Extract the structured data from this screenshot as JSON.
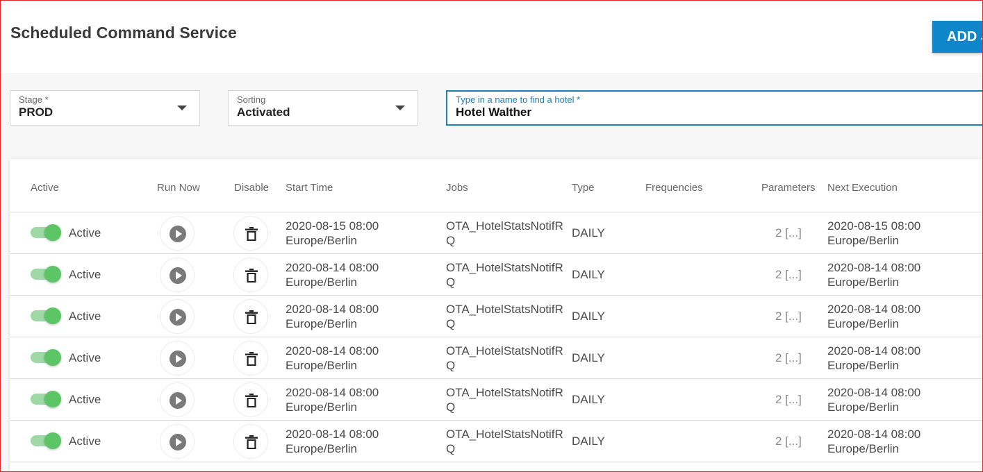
{
  "app": {
    "title": "Scheduled Command Service",
    "add_button_label": "ADD J"
  },
  "filters": {
    "stage": {
      "label": "Stage *",
      "value": "PROD"
    },
    "sorting": {
      "label": "Sorting",
      "value": "Activated"
    },
    "hotel_search": {
      "label": "Type in a name to find a hotel *",
      "value": "Hotel Walther"
    }
  },
  "table": {
    "columns": [
      "Active",
      "Run Now",
      "Disable",
      "Start Time",
      "Jobs",
      "Type",
      "Frequencies",
      "Parameters",
      "Next Execution"
    ],
    "rows": [
      {
        "active_label": "Active",
        "start_date": "2020-08-15 08:00",
        "start_tz": "Europe/Berlin",
        "job_1": "OTA_HotelStatsNotifR",
        "job_2": "Q",
        "type": "DAILY",
        "frequencies": "",
        "parameters": "2 [...]",
        "next_date": "2020-08-15 08:00",
        "next_tz": "Europe/Berlin"
      },
      {
        "active_label": "Active",
        "start_date": "2020-08-14 08:00",
        "start_tz": "Europe/Berlin",
        "job_1": "OTA_HotelStatsNotifR",
        "job_2": "Q",
        "type": "DAILY",
        "frequencies": "",
        "parameters": "2 [...]",
        "next_date": "2020-08-14 08:00",
        "next_tz": "Europe/Berlin"
      },
      {
        "active_label": "Active",
        "start_date": "2020-08-14 08:00",
        "start_tz": "Europe/Berlin",
        "job_1": "OTA_HotelStatsNotifR",
        "job_2": "Q",
        "type": "DAILY",
        "frequencies": "",
        "parameters": "2 [...]",
        "next_date": "2020-08-14 08:00",
        "next_tz": "Europe/Berlin"
      },
      {
        "active_label": "Active",
        "start_date": "2020-08-14 08:00",
        "start_tz": "Europe/Berlin",
        "job_1": "OTA_HotelStatsNotifR",
        "job_2": "Q",
        "type": "DAILY",
        "frequencies": "",
        "parameters": "2 [...]",
        "next_date": "2020-08-14 08:00",
        "next_tz": "Europe/Berlin"
      },
      {
        "active_label": "Active",
        "start_date": "2020-08-14 08:00",
        "start_tz": "Europe/Berlin",
        "job_1": "OTA_HotelStatsNotifR",
        "job_2": "Q",
        "type": "DAILY",
        "frequencies": "",
        "parameters": "2 [...]",
        "next_date": "2020-08-14 08:00",
        "next_tz": "Europe/Berlin"
      },
      {
        "active_label": "Active",
        "start_date": "2020-08-14 08:00",
        "start_tz": "Europe/Berlin",
        "job_1": "OTA_HotelStatsNotifR",
        "job_2": "Q",
        "type": "DAILY",
        "frequencies": "",
        "parameters": "2 [...]",
        "next_date": "2020-08-14 08:00",
        "next_tz": "Europe/Berlin"
      }
    ]
  },
  "icons": {
    "run": "play-icon",
    "disable": "trash-icon",
    "dropdown": "chevron-down-icon"
  },
  "colors": {
    "accent": "#0f86c9",
    "focus": "#1a7fb3",
    "toggle_on": "#5cc566",
    "toggle_track": "#9fd9a8"
  }
}
